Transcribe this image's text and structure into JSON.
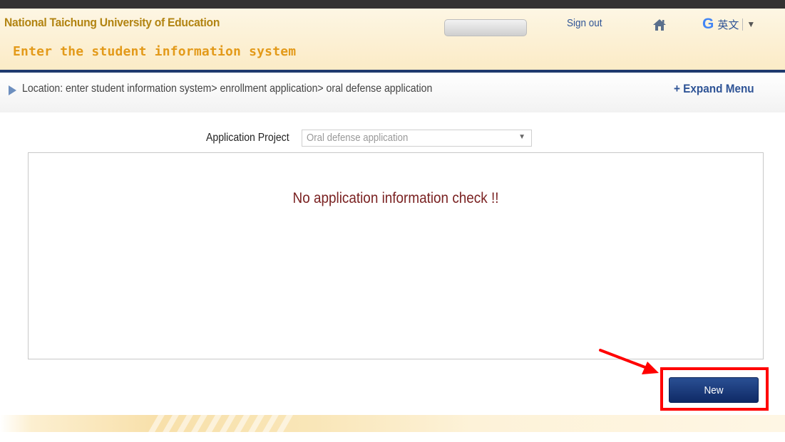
{
  "header": {
    "university": "National Taichung University of Education",
    "system_title": "Enter the student information system",
    "sign_out": "Sign out",
    "home_icon": "home-icon",
    "translate": {
      "logo": "G",
      "language": "英文",
      "arrow": "▼"
    }
  },
  "breadcrumb": {
    "text": "Location: enter student information system> enrollment application> oral defense application",
    "expand_menu": "+ Expand Menu"
  },
  "form": {
    "project_label": "Application Project",
    "project_value": "Oral defense application",
    "select_arrow": "▼"
  },
  "panel": {
    "message": "No application information check !!"
  },
  "actions": {
    "new_label": "New"
  },
  "colors": {
    "brand_navy": "#1f3a6e",
    "title_gold": "#b28412",
    "title_orange": "#e39a1a",
    "link_blue": "#2f5496",
    "message_red": "#7a2222",
    "highlight_red": "#ff0000"
  }
}
